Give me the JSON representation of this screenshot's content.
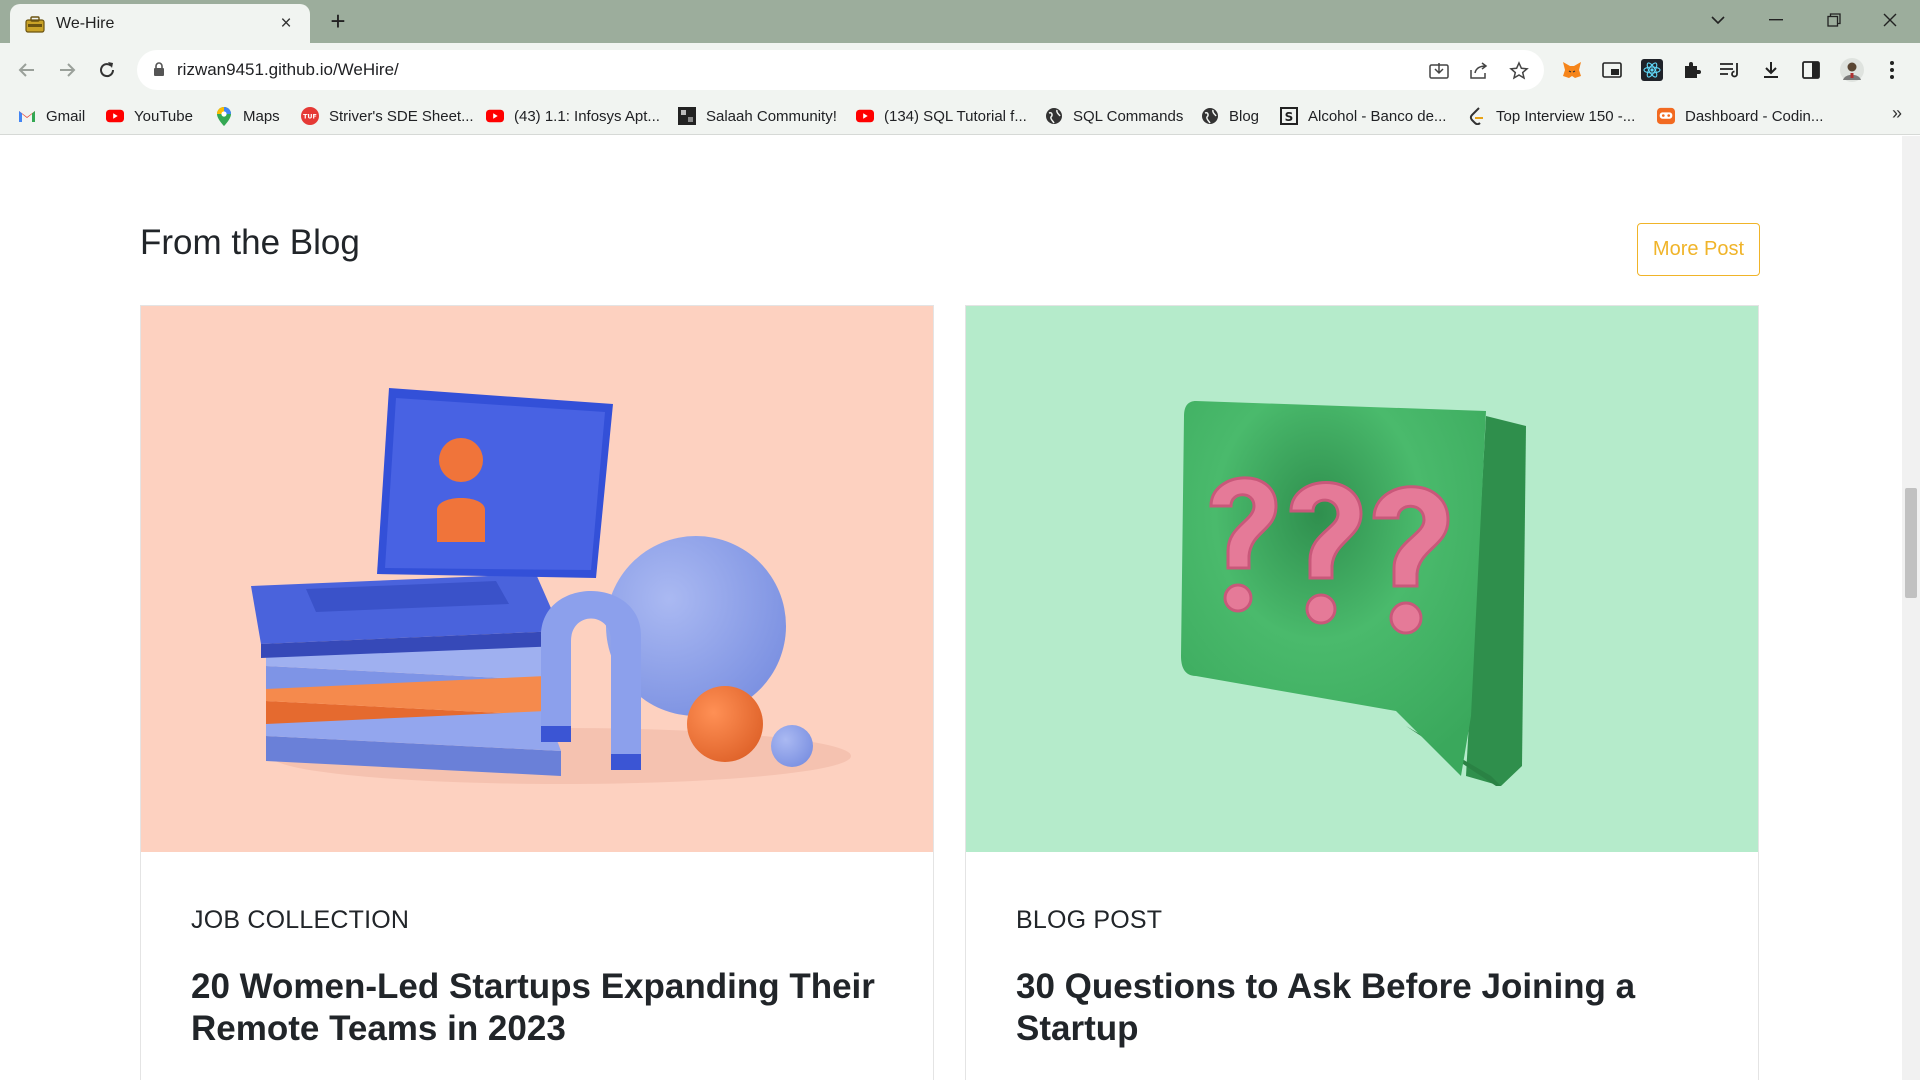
{
  "browser": {
    "tab_title": "We-Hire",
    "tab_close": "×",
    "new_tab": "+",
    "url": "rizwan9451.github.io/WeHire/",
    "bookmarks_more": "»",
    "bookmarks": [
      {
        "label": "Gmail",
        "icon": "gmail-icon",
        "color": "#ea4335"
      },
      {
        "label": "YouTube",
        "icon": "youtube-icon",
        "color": "#ff0000"
      },
      {
        "label": "Maps",
        "icon": "maps-icon",
        "color": "#34a853"
      },
      {
        "label": "Striver's SDE Sheet...",
        "icon": "tuf-icon",
        "color": "#e53935"
      },
      {
        "label": "(43) 1.1: Infosys Apt...",
        "icon": "youtube-icon",
        "color": "#ff0000"
      },
      {
        "label": "Salaah Community!",
        "icon": "salaah-icon",
        "color": "#222222"
      },
      {
        "label": "(134) SQL Tutorial f...",
        "icon": "youtube-icon",
        "color": "#ff0000"
      },
      {
        "label": "SQL Commands",
        "icon": "globe-icon",
        "color": "#333333"
      },
      {
        "label": "Blog",
        "icon": "globe-icon",
        "color": "#333333"
      },
      {
        "label": "Alcohol - Banco de...",
        "icon": "s-icon",
        "color": "#222222"
      },
      {
        "label": "Top Interview 150 -...",
        "icon": "leetcode-icon",
        "color": "#e8a317"
      },
      {
        "label": "Dashboard - Codin...",
        "icon": "codingninjas-icon",
        "color": "#f26a21"
      }
    ]
  },
  "page": {
    "section_title": "From the Blog",
    "more_button": "More Post",
    "accent": "#f0b429",
    "cards": [
      {
        "category": "JOB COLLECTION",
        "title": "20 Women-Led Startups Expanding Their Remote Teams in 2023",
        "image_bg": "#fdd1c0",
        "image": "laptop-illustration"
      },
      {
        "category": "BLOG POST",
        "title": "30 Questions to Ask Before Joining a Startup",
        "image_bg": "#b5ebcb",
        "image": "question-speech-bubble"
      }
    ]
  }
}
